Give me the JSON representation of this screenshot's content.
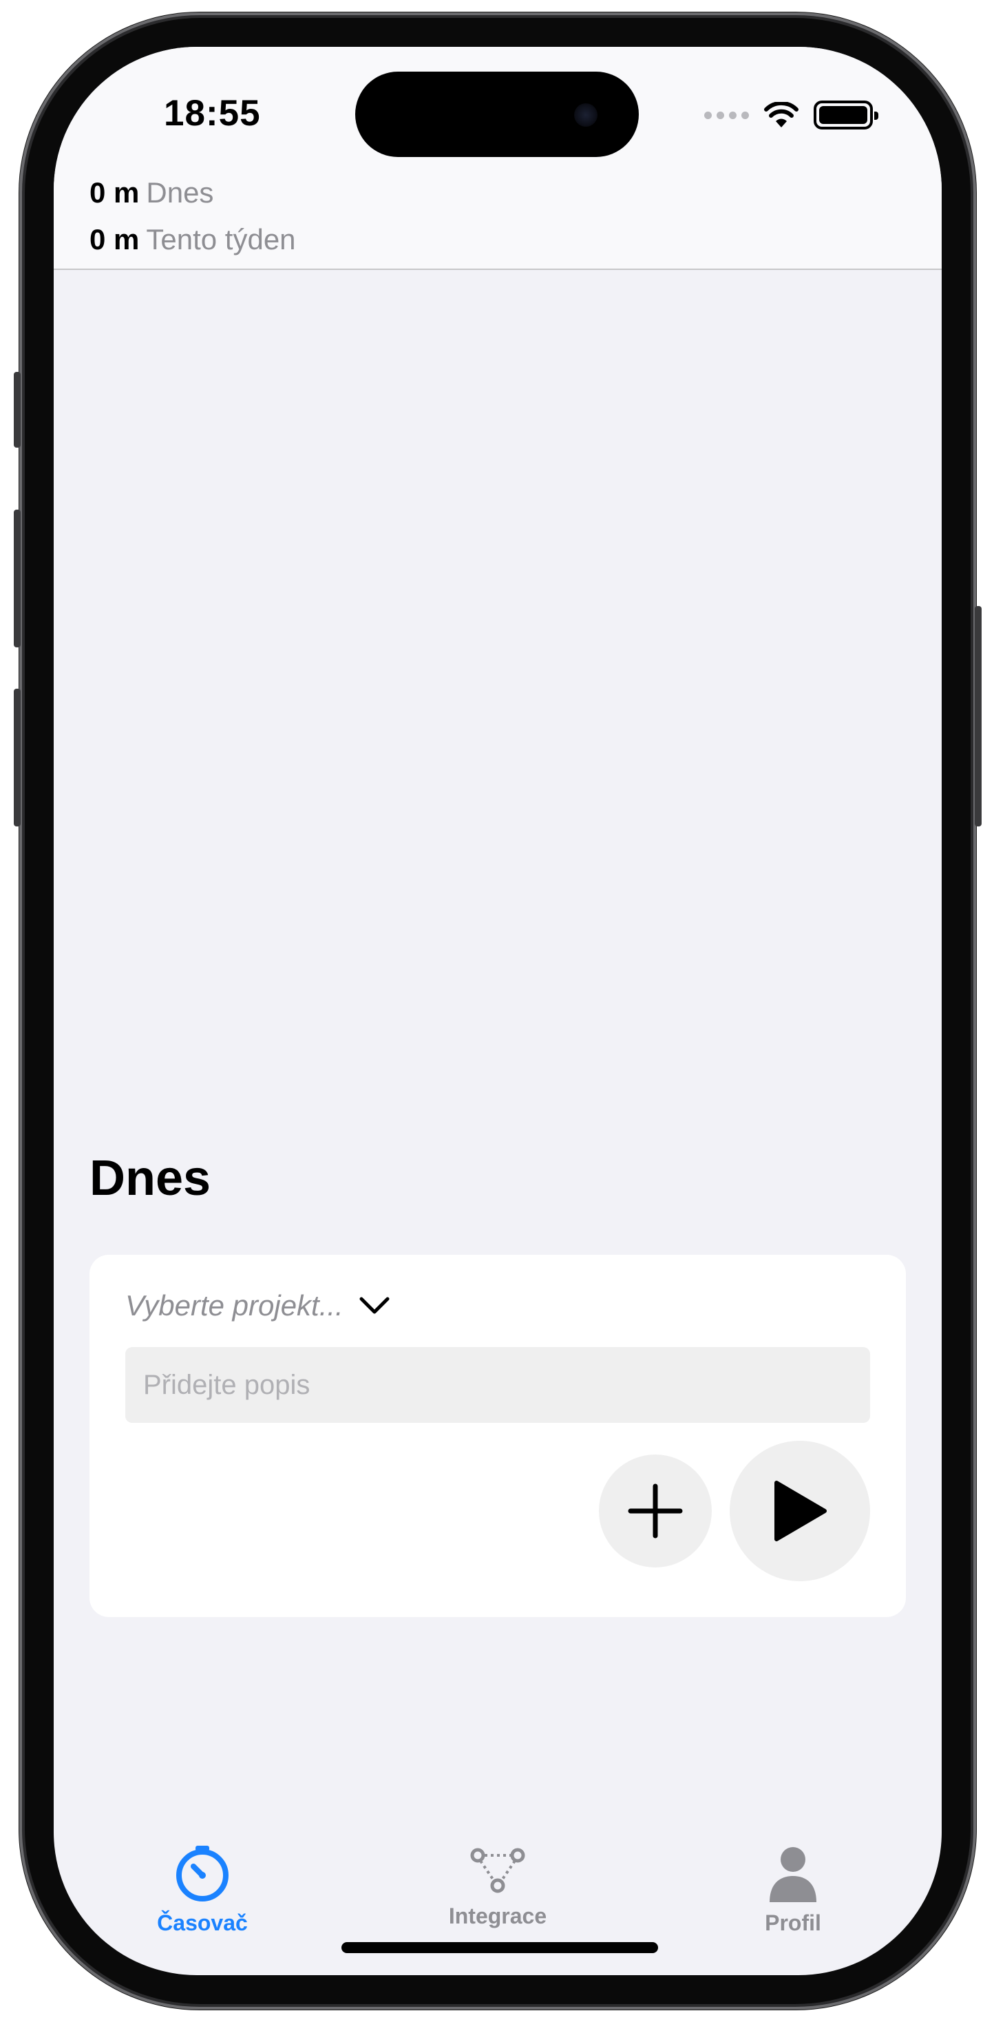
{
  "status_bar": {
    "time": "18:55",
    "icons": [
      "cellular-signal-icon",
      "wifi-icon",
      "battery-icon"
    ]
  },
  "summary": {
    "today": {
      "value": "0 m",
      "label": "Dnes"
    },
    "week": {
      "value": "0 m",
      "label": "Tento týden"
    }
  },
  "section": {
    "title": "Dnes"
  },
  "entry_card": {
    "project_placeholder": "Vyberte projekt...",
    "description_placeholder": "Přidejte popis",
    "description_value": "",
    "add_icon": "plus-icon",
    "start_icon": "play-icon"
  },
  "tab_bar": {
    "items": [
      {
        "label": "Časovač",
        "icon": "timer-icon",
        "active": true
      },
      {
        "label": "Integrace",
        "icon": "integration-icon",
        "active": false
      },
      {
        "label": "Profil",
        "icon": "profile-icon",
        "active": false
      }
    ]
  },
  "colors": {
    "accent": "#1a82ff",
    "background": "#f2f2f7",
    "inactive": "#8e8e93"
  }
}
